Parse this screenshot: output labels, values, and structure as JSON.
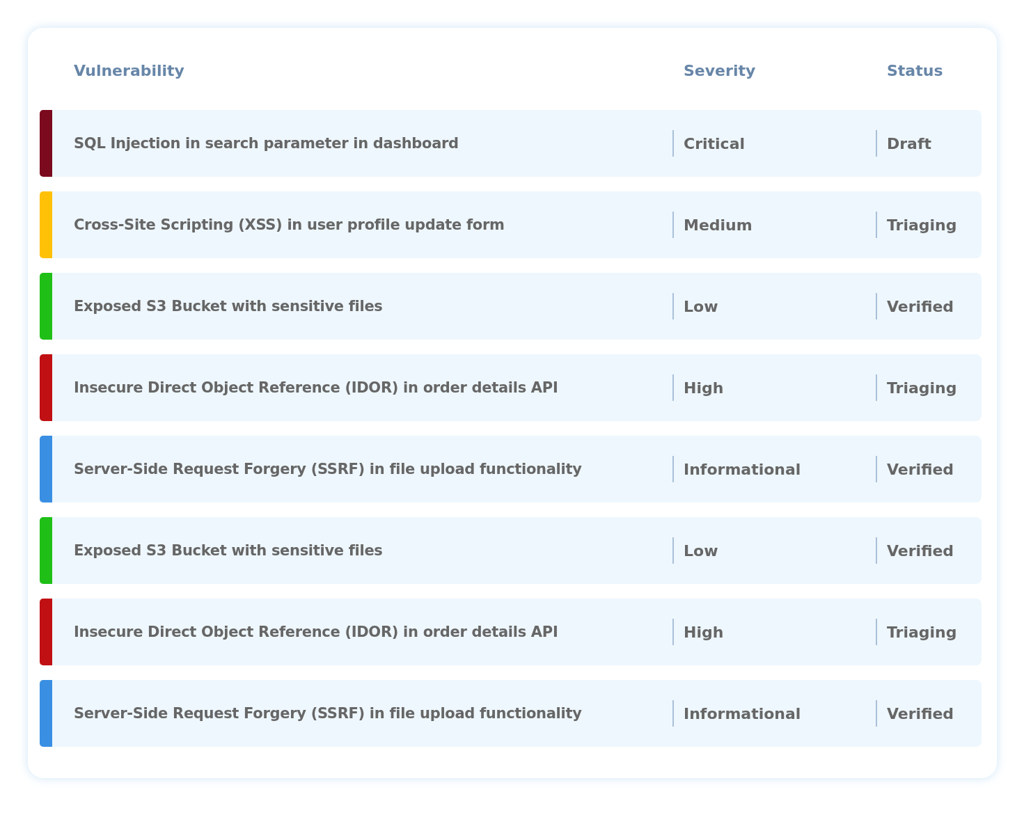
{
  "table": {
    "columns": [
      "Vulnerability",
      "Severity",
      "Status"
    ],
    "rows": [
      {
        "vulnerability": "SQL Injection in search parameter in dashboard",
        "severity": "Critical",
        "status": "Draft",
        "color": "#7b0a1f"
      },
      {
        "vulnerability": "Cross-Site Scripting (XSS) in user profile update form",
        "severity": "Medium",
        "status": "Triaging",
        "color": "#ffc107"
      },
      {
        "vulnerability": "Exposed S3 Bucket with sensitive files",
        "severity": "Low",
        "status": "Verified",
        "color": "#1fbf17"
      },
      {
        "vulnerability": "Insecure Direct Object Reference (IDOR) in order details API",
        "severity": "High",
        "status": "Triaging",
        "color": "#c01014"
      },
      {
        "vulnerability": "Server-Side Request Forgery (SSRF) in file upload functionality",
        "severity": "Informational",
        "status": "Verified",
        "color": "#3a8fe3"
      },
      {
        "vulnerability": "Exposed S3 Bucket with sensitive files",
        "severity": "Low",
        "status": "Verified",
        "color": "#1fbf17"
      },
      {
        "vulnerability": "Insecure Direct Object Reference (IDOR) in order details API",
        "severity": "High",
        "status": "Triaging",
        "color": "#c01014"
      },
      {
        "vulnerability": "Server-Side Request Forgery (SSRF) in file upload functionality",
        "severity": "Informational",
        "status": "Verified",
        "color": "#3a8fe3"
      }
    ]
  }
}
